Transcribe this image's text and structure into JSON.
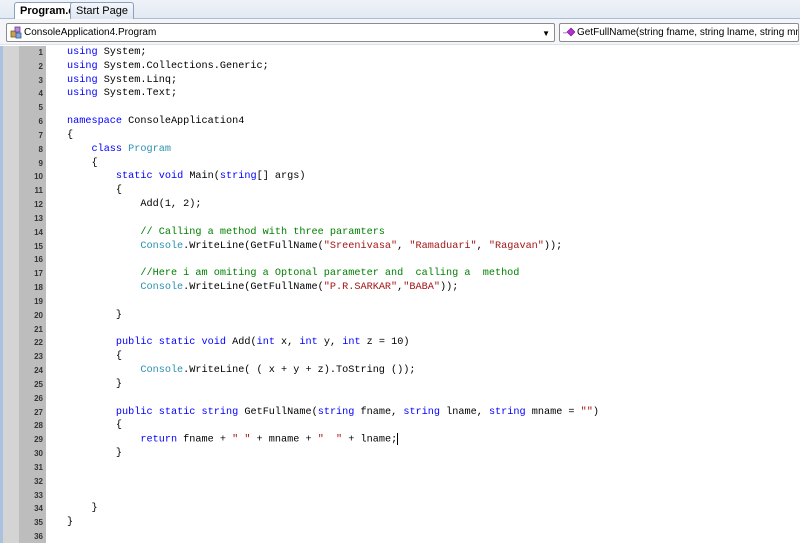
{
  "tabs": [
    {
      "label": "Program.cs",
      "active": true
    },
    {
      "label": "Start Page",
      "active": false
    }
  ],
  "nav": {
    "class_combo": "ConsoleApplication4.Program",
    "member_combo": "GetFullName(string fname, string lname, string mname)",
    "class_icon": "class-icon",
    "member_icon": "method-icon"
  },
  "colors": {
    "keyword": "#0000ff",
    "type": "#2b91af",
    "string": "#a31515",
    "comment": "#008000"
  },
  "code_lines": [
    [
      [
        "kw",
        "using"
      ],
      [
        "pl",
        " System;"
      ]
    ],
    [
      [
        "kw",
        "using"
      ],
      [
        "pl",
        " System.Collections.Generic;"
      ]
    ],
    [
      [
        "kw",
        "using"
      ],
      [
        "pl",
        " System.Linq;"
      ]
    ],
    [
      [
        "kw",
        "using"
      ],
      [
        "pl",
        " System.Text;"
      ]
    ],
    [],
    [
      [
        "kw",
        "namespace"
      ],
      [
        "pl",
        " ConsoleApplication4"
      ]
    ],
    [
      [
        "pl",
        "{"
      ]
    ],
    [
      [
        "pl",
        "    "
      ],
      [
        "kw",
        "class"
      ],
      [
        "pl",
        " "
      ],
      [
        "ty",
        "Program"
      ]
    ],
    [
      [
        "pl",
        "    {"
      ]
    ],
    [
      [
        "pl",
        "        "
      ],
      [
        "kw",
        "static"
      ],
      [
        "pl",
        " "
      ],
      [
        "kw",
        "void"
      ],
      [
        "pl",
        " Main("
      ],
      [
        "kw",
        "string"
      ],
      [
        "pl",
        "[] args)"
      ]
    ],
    [
      [
        "pl",
        "        {"
      ]
    ],
    [
      [
        "pl",
        "            Add(1, 2);"
      ]
    ],
    [],
    [
      [
        "pl",
        "            "
      ],
      [
        "cm",
        "// Calling a method with three paramters"
      ]
    ],
    [
      [
        "pl",
        "            "
      ],
      [
        "ty",
        "Console"
      ],
      [
        "pl",
        ".WriteLine(GetFullName("
      ],
      [
        "st",
        "\"Sreenivasa\""
      ],
      [
        "pl",
        ", "
      ],
      [
        "st",
        "\"Ramaduari\""
      ],
      [
        "pl",
        ", "
      ],
      [
        "st",
        "\"Ragavan\""
      ],
      [
        "pl",
        "));"
      ]
    ],
    [],
    [
      [
        "pl",
        "            "
      ],
      [
        "cm",
        "//Here i am omiting a Optonal parameter and  calling a  method"
      ]
    ],
    [
      [
        "pl",
        "            "
      ],
      [
        "ty",
        "Console"
      ],
      [
        "pl",
        ".WriteLine(GetFullName("
      ],
      [
        "st",
        "\"P.R.SARKAR\""
      ],
      [
        "pl",
        ","
      ],
      [
        "st",
        "\"BABA\""
      ],
      [
        "pl",
        "));"
      ]
    ],
    [],
    [
      [
        "pl",
        "        }"
      ]
    ],
    [],
    [
      [
        "pl",
        "        "
      ],
      [
        "kw",
        "public"
      ],
      [
        "pl",
        " "
      ],
      [
        "kw",
        "static"
      ],
      [
        "pl",
        " "
      ],
      [
        "kw",
        "void"
      ],
      [
        "pl",
        " Add("
      ],
      [
        "kw",
        "int"
      ],
      [
        "pl",
        " x, "
      ],
      [
        "kw",
        "int"
      ],
      [
        "pl",
        " y, "
      ],
      [
        "kw",
        "int"
      ],
      [
        "pl",
        " z = 10)"
      ]
    ],
    [
      [
        "pl",
        "        {"
      ]
    ],
    [
      [
        "pl",
        "            "
      ],
      [
        "ty",
        "Console"
      ],
      [
        "pl",
        ".WriteLine( ( x + y + z).ToString ());"
      ]
    ],
    [
      [
        "pl",
        "        }"
      ]
    ],
    [],
    [
      [
        "pl",
        "        "
      ],
      [
        "kw",
        "public"
      ],
      [
        "pl",
        " "
      ],
      [
        "kw",
        "static"
      ],
      [
        "pl",
        " "
      ],
      [
        "kw",
        "string"
      ],
      [
        "pl",
        " GetFullName("
      ],
      [
        "kw",
        "string"
      ],
      [
        "pl",
        " fname, "
      ],
      [
        "kw",
        "string"
      ],
      [
        "pl",
        " lname, "
      ],
      [
        "kw",
        "string"
      ],
      [
        "pl",
        " mname = "
      ],
      [
        "st",
        "\"\""
      ],
      [
        "pl",
        ")"
      ]
    ],
    [
      [
        "pl",
        "        {"
      ]
    ],
    [
      [
        "pl",
        "            "
      ],
      [
        "kw",
        "return"
      ],
      [
        "pl",
        " fname + "
      ],
      [
        "st",
        "\" \""
      ],
      [
        "pl",
        " + mname + "
      ],
      [
        "st",
        "\"  \""
      ],
      [
        "pl",
        " + lname;"
      ],
      [
        "caret",
        ""
      ]
    ],
    [
      [
        "pl",
        "        }"
      ]
    ],
    [],
    [],
    [],
    [
      [
        "pl",
        "    }"
      ]
    ],
    [
      [
        "pl",
        "}"
      ]
    ],
    []
  ]
}
